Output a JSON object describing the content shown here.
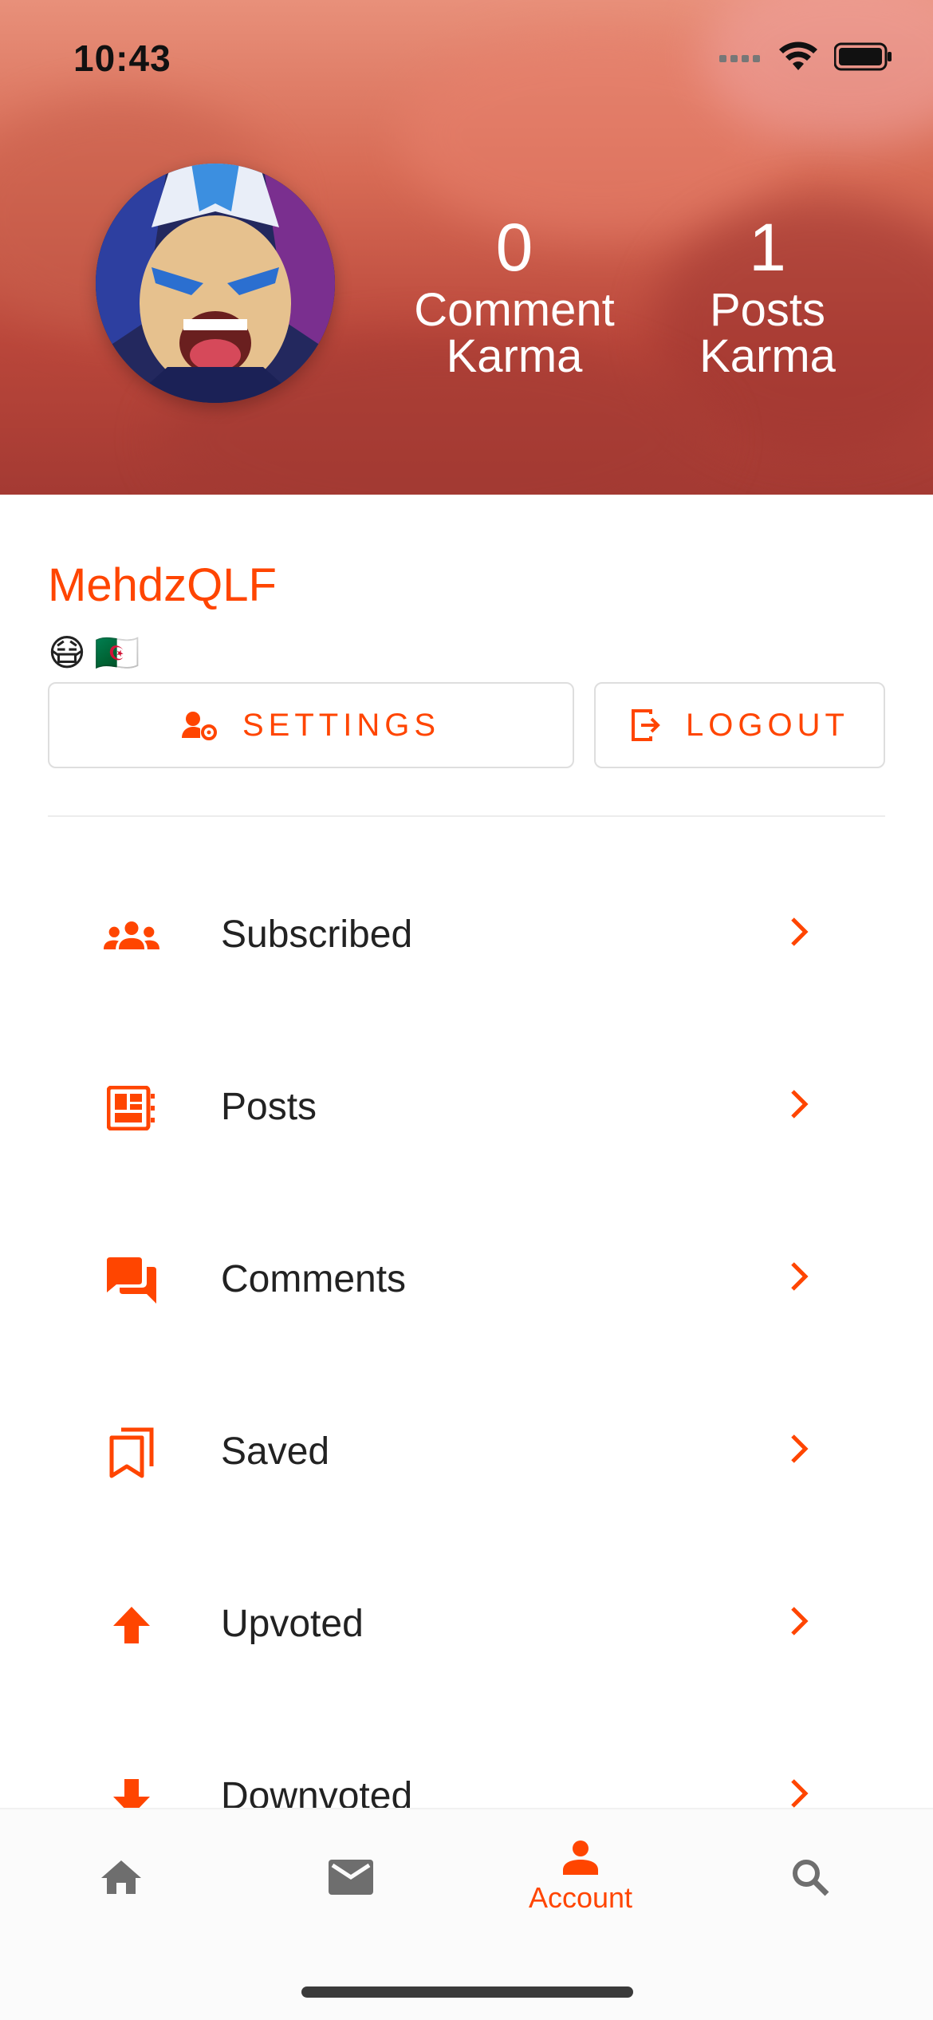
{
  "status_bar": {
    "time": "10:43"
  },
  "header": {
    "comment_karma": {
      "value": "0",
      "label": "Comment Karma"
    },
    "posts_karma": {
      "value": "1",
      "label": "Posts Karma"
    }
  },
  "profile": {
    "username": "MehdzQLF",
    "emojis": [
      "😷",
      "🇩🇿"
    ]
  },
  "buttons": {
    "settings_label": "SETTINGS",
    "logout_label": "LOGOUT"
  },
  "menu": {
    "items": [
      {
        "label": "Subscribed",
        "icon": "group-icon"
      },
      {
        "label": "Posts",
        "icon": "posts-icon"
      },
      {
        "label": "Comments",
        "icon": "comments-icon"
      },
      {
        "label": "Saved",
        "icon": "bookmark-icon"
      },
      {
        "label": "Upvoted",
        "icon": "arrow-up-icon"
      },
      {
        "label": "Downvoted",
        "icon": "arrow-down-icon"
      }
    ]
  },
  "bottom_nav": {
    "items": [
      {
        "icon": "home-icon",
        "label": ""
      },
      {
        "icon": "mail-icon",
        "label": ""
      },
      {
        "icon": "account-icon",
        "label": "Account",
        "active": true
      },
      {
        "icon": "search-icon",
        "label": ""
      }
    ]
  },
  "colors": {
    "accent": "#ff4500",
    "inactive_icon": "#6e6e6e"
  }
}
